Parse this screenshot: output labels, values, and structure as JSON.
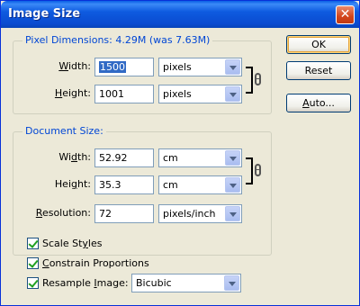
{
  "window": {
    "title": "Image Size",
    "close_glyph": "✕"
  },
  "pixel_dimensions": {
    "legend": "Pixel Dimensions:  4.29M (was 7.63M)",
    "width": {
      "label_prefix": "",
      "label_mnemonic": "W",
      "label_rest": "idth:",
      "value": "1500",
      "unit": "pixels"
    },
    "height": {
      "label_prefix": "",
      "label_mnemonic": "H",
      "label_rest": "eight:",
      "value": "1001",
      "unit": "pixels"
    }
  },
  "document_size": {
    "legend": "Document Size:",
    "width": {
      "label_prefix": "Wi",
      "label_mnemonic": "d",
      "label_rest": "th:",
      "value": "52.92",
      "unit": "cm"
    },
    "height": {
      "label_prefix": "Hei",
      "label_mnemonic": "g",
      "label_rest": "ht:",
      "value": "35.3",
      "unit": "cm"
    },
    "resolution": {
      "label_prefix": "",
      "label_mnemonic": "R",
      "label_rest": "esolution:",
      "value": "72",
      "unit": "pixels/inch"
    }
  },
  "options": {
    "scale_styles": {
      "prefix": "Scale St",
      "mnemonic": "y",
      "rest": "les",
      "checked": true
    },
    "constrain": {
      "prefix": "",
      "mnemonic": "C",
      "rest": "onstrain Proportions",
      "checked": true
    },
    "resample": {
      "prefix": "Resample ",
      "mnemonic": "I",
      "rest": "mage:",
      "checked": true,
      "method": "Bicubic"
    }
  },
  "buttons": {
    "ok": "OK",
    "reset": "Reset",
    "auto_prefix": "",
    "auto_mnemonic": "A",
    "auto_rest": "uto..."
  },
  "icons": {
    "chain": "link-icon",
    "dropdown": "chevron-down-icon",
    "check": "checkmark-icon"
  },
  "colors": {
    "title_bar": "#0a5fe6",
    "group_legend": "#0046d5",
    "selection": "#316ac5"
  }
}
